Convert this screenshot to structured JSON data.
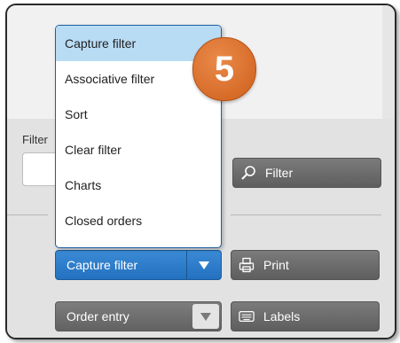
{
  "dropdown_menu": {
    "items": [
      "Capture filter",
      "Associative filter",
      "Sort",
      "Clear filter",
      "Charts",
      "Closed orders"
    ],
    "active_index": 0
  },
  "badge": {
    "number": "5"
  },
  "filter_panel": {
    "label": "Filter",
    "filter_button_label": "Filter",
    "print_button_label": "Print",
    "labels_button_label": "Labels"
  },
  "selects": {
    "view_select_value": "Capture filter",
    "mode_select_value": "Order entry"
  },
  "colors": {
    "accent_blue": "#2a7ac8",
    "badge_orange": "#d9692a",
    "menu_highlight": "#b9dcf5"
  },
  "icons": [
    "search-icon",
    "print-icon",
    "labels-icon",
    "chevron-down-icon"
  ]
}
